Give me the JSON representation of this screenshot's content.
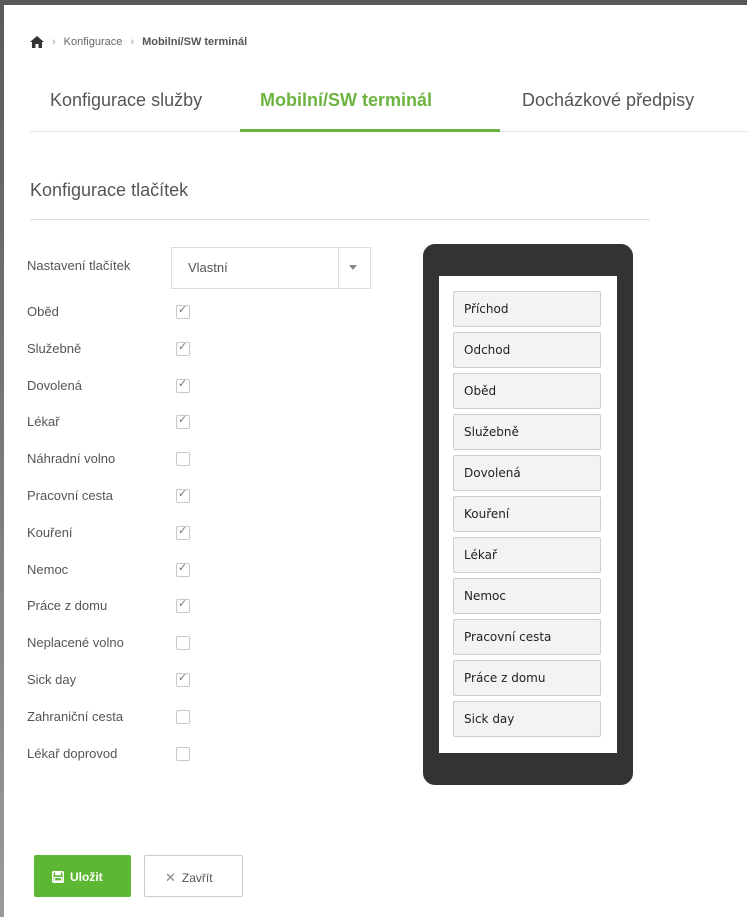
{
  "breadcrumb": {
    "items": [
      "Konfigurace",
      "Mobilní/SW terminál"
    ]
  },
  "tabs": [
    {
      "label": "Konfigurace služby",
      "active": false
    },
    {
      "label": "Mobilní/SW terminál",
      "active": true
    },
    {
      "label": "Docházkové předpisy",
      "active": false
    }
  ],
  "section": {
    "title": "Konfigurace tlačítek"
  },
  "settings": {
    "label": "Nastavení tlačítek",
    "value": "Vlastní"
  },
  "options": [
    {
      "label": "Oběd",
      "checked": true
    },
    {
      "label": "Služebně",
      "checked": true
    },
    {
      "label": "Dovolená",
      "checked": true
    },
    {
      "label": "Lékař",
      "checked": true
    },
    {
      "label": "Náhradní volno",
      "checked": false
    },
    {
      "label": "Pracovní cesta",
      "checked": true
    },
    {
      "label": "Kouření",
      "checked": true
    },
    {
      "label": "Nemoc",
      "checked": true
    },
    {
      "label": "Práce z domu",
      "checked": true
    },
    {
      "label": "Neplacené volno",
      "checked": false
    },
    {
      "label": "Sick day",
      "checked": true
    },
    {
      "label": "Zahraniční cesta",
      "checked": false
    },
    {
      "label": "Lékař doprovod",
      "checked": false
    }
  ],
  "preview": {
    "buttons": [
      "Příchod",
      "Odchod",
      "Oběd",
      "Služebně",
      "Dovolená",
      "Kouření",
      "Lékař",
      "Nemoc",
      "Pracovní cesta",
      "Práce z domu",
      "Sick day"
    ]
  },
  "actions": {
    "save_label": "Uložit",
    "close_label": "Zavřít"
  },
  "colors": {
    "accent": "#6cb33f",
    "save": "#5cb832",
    "phone": "#333333"
  }
}
